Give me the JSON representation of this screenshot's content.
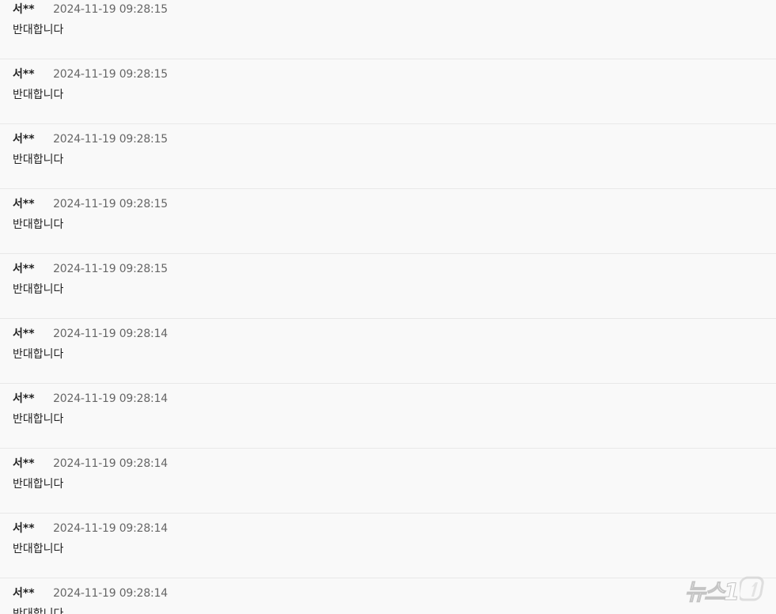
{
  "comments": [
    {
      "author": "서**",
      "timestamp": "2024-11-19 09:28:15",
      "text": "반대합니다"
    },
    {
      "author": "서**",
      "timestamp": "2024-11-19 09:28:15",
      "text": "반대합니다"
    },
    {
      "author": "서**",
      "timestamp": "2024-11-19 09:28:15",
      "text": "반대합니다"
    },
    {
      "author": "서**",
      "timestamp": "2024-11-19 09:28:15",
      "text": "반대합니다"
    },
    {
      "author": "서**",
      "timestamp": "2024-11-19 09:28:15",
      "text": "반대합니다"
    },
    {
      "author": "서**",
      "timestamp": "2024-11-19 09:28:14",
      "text": "반대합니다"
    },
    {
      "author": "서**",
      "timestamp": "2024-11-19 09:28:14",
      "text": "반대합니다"
    },
    {
      "author": "서**",
      "timestamp": "2024-11-19 09:28:14",
      "text": "반대합니다"
    },
    {
      "author": "서**",
      "timestamp": "2024-11-19 09:28:14",
      "text": "반대합니다"
    },
    {
      "author": "서**",
      "timestamp": "2024-11-19 09:28:14",
      "text": "반대합니다"
    }
  ],
  "watermark": {
    "text": "뉴스1",
    "logo_icon": "news1-logo"
  }
}
